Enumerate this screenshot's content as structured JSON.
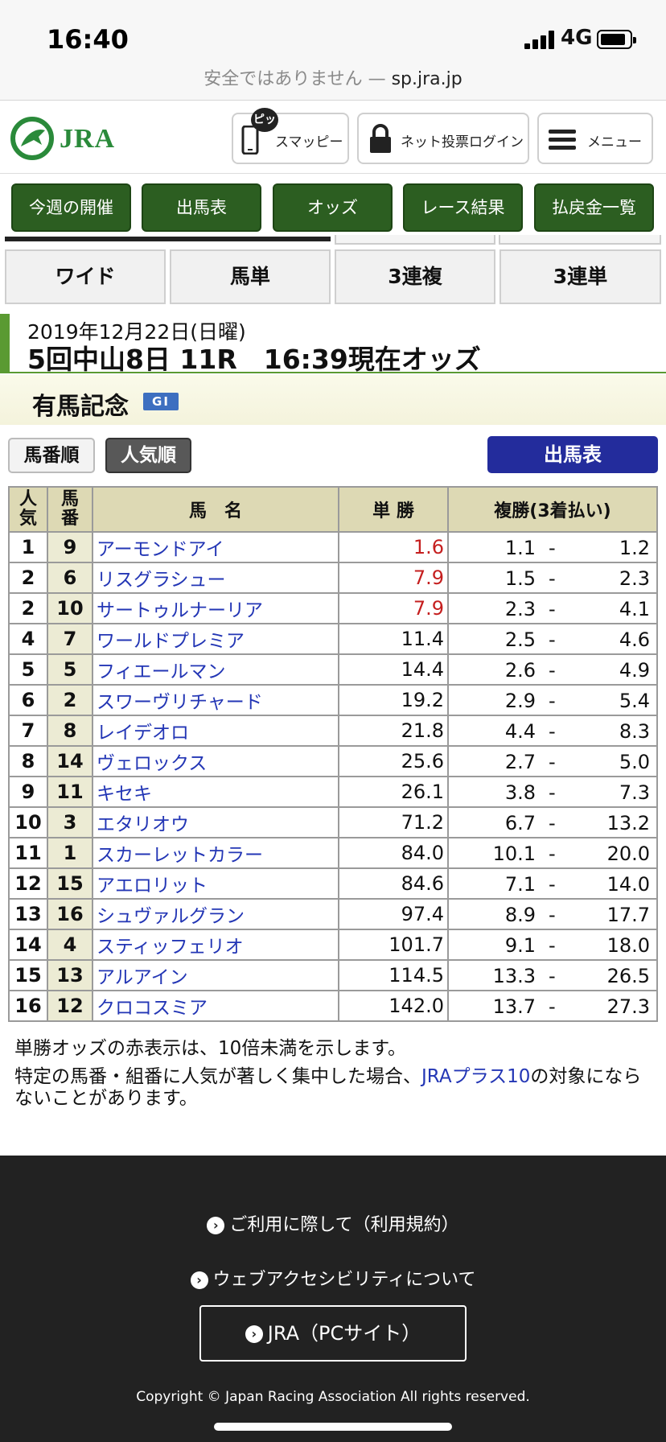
{
  "status": {
    "time": "16:40",
    "network": "4G",
    "url_prefix": "安全ではありません — ",
    "url_host": "sp.jra.jp"
  },
  "header": {
    "logo_text": "JRA",
    "pit_badge": "ピッ",
    "smappy_label": "スマッピー",
    "login_label": "ネット投票ログイン",
    "menu_label": "メニュー"
  },
  "nav": [
    "今週の開催",
    "出馬表",
    "オッズ",
    "レース結果",
    "払戻金一覧"
  ],
  "bet_tabs": [
    "ワイド",
    "馬単",
    "3連複",
    "3連単"
  ],
  "race": {
    "date": "2019年12月22日(日曜)",
    "info": "5回中山8日 11R　16:39現在オッズ",
    "name": "有馬記念",
    "grade": "GI"
  },
  "sort": {
    "by_number": "馬番順",
    "by_popularity": "人気順",
    "entries_button": "出馬表"
  },
  "table": {
    "headers": {
      "pop": "人気",
      "no": "馬番",
      "name": "馬　名",
      "win": "単 勝",
      "place": "複勝(3着払い)"
    },
    "rows": [
      {
        "pop": "1",
        "no": "9",
        "name": "アーモンドアイ",
        "win": "1.6",
        "red": true,
        "lo": "1.1",
        "hi": "1.2"
      },
      {
        "pop": "2",
        "no": "6",
        "name": "リスグラシュー",
        "win": "7.9",
        "red": true,
        "lo": "1.5",
        "hi": "2.3"
      },
      {
        "pop": "2",
        "no": "10",
        "name": "サートゥルナーリア",
        "win": "7.9",
        "red": true,
        "lo": "2.3",
        "hi": "4.1"
      },
      {
        "pop": "4",
        "no": "7",
        "name": "ワールドプレミア",
        "win": "11.4",
        "red": false,
        "lo": "2.5",
        "hi": "4.6"
      },
      {
        "pop": "5",
        "no": "5",
        "name": "フィエールマン",
        "win": "14.4",
        "red": false,
        "lo": "2.6",
        "hi": "4.9"
      },
      {
        "pop": "6",
        "no": "2",
        "name": "スワーヴリチャード",
        "win": "19.2",
        "red": false,
        "lo": "2.9",
        "hi": "5.4"
      },
      {
        "pop": "7",
        "no": "8",
        "name": "レイデオロ",
        "win": "21.8",
        "red": false,
        "lo": "4.4",
        "hi": "8.3"
      },
      {
        "pop": "8",
        "no": "14",
        "name": "ヴェロックス",
        "win": "25.6",
        "red": false,
        "lo": "2.7",
        "hi": "5.0"
      },
      {
        "pop": "9",
        "no": "11",
        "name": "キセキ",
        "win": "26.1",
        "red": false,
        "lo": "3.8",
        "hi": "7.3"
      },
      {
        "pop": "10",
        "no": "3",
        "name": "エタリオウ",
        "win": "71.2",
        "red": false,
        "lo": "6.7",
        "hi": "13.2"
      },
      {
        "pop": "11",
        "no": "1",
        "name": "スカーレットカラー",
        "win": "84.0",
        "red": false,
        "lo": "10.1",
        "hi": "20.0"
      },
      {
        "pop": "12",
        "no": "15",
        "name": "アエロリット",
        "win": "84.6",
        "red": false,
        "lo": "7.1",
        "hi": "14.0"
      },
      {
        "pop": "13",
        "no": "16",
        "name": "シュヴァルグラン",
        "win": "97.4",
        "red": false,
        "lo": "8.9",
        "hi": "17.7"
      },
      {
        "pop": "14",
        "no": "4",
        "name": "スティッフェリオ",
        "win": "101.7",
        "red": false,
        "lo": "9.1",
        "hi": "18.0"
      },
      {
        "pop": "15",
        "no": "13",
        "name": "アルアイン",
        "win": "114.5",
        "red": false,
        "lo": "13.3",
        "hi": "26.5"
      },
      {
        "pop": "16",
        "no": "12",
        "name": "クロコスミア",
        "win": "142.0",
        "red": false,
        "lo": "13.7",
        "hi": "27.3"
      }
    ],
    "dash": "-"
  },
  "notes": {
    "red_note": "単勝オッズの赤表示は、10倍未満を示します。",
    "plus10_before": "特定の馬番・組番に人気が著しく集中した場合、",
    "plus10_link": "JRAプラス10",
    "plus10_after": "の対象にならないことがあります。"
  },
  "footer": {
    "terms": "ご利用に際して（利用規約）",
    "accessibility": "ウェブアクセシビリティについて",
    "pc_site": "JRA（PCサイト）",
    "copyright": "Copyright © Japan Racing Association All rights reserved."
  },
  "colors": {
    "nav_green": "#2c5e21",
    "entries_blue": "#232c9c",
    "link_blue": "#2336b5",
    "odds_red": "#c51f1f",
    "footer_bg": "#222222"
  }
}
